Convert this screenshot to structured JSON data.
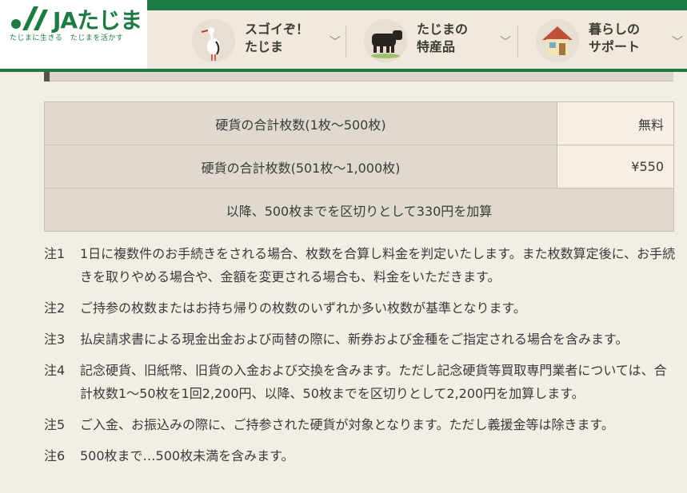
{
  "brand": {
    "logo_text": "JAたじま",
    "tagline": "たじまに生きる　たじまを活かす",
    "primary_color": "#1e7a43"
  },
  "nav": [
    {
      "label_line1": "スゴイぞ！",
      "label_line2": "たじま",
      "icon": "stork-icon"
    },
    {
      "label_line1": "たじまの",
      "label_line2": "特産品",
      "icon": "cow-icon"
    },
    {
      "label_line1": "暮らしの",
      "label_line2": "サポート",
      "icon": "house-icon"
    }
  ],
  "fee_table": {
    "rows": [
      {
        "condition": "硬貨の合計枚数(1枚～500枚)",
        "price": "無料"
      },
      {
        "condition": "硬貨の合計枚数(501枚～1,000枚)",
        "price": "¥550"
      }
    ],
    "footer": "以降、500枚までを区切りとして330円を加算"
  },
  "notes": [
    {
      "label": "注1",
      "text": "1日に複数件のお手続きをされる場合、枚数を合算し料金を判定いたします。また枚数算定後に、お手続きを取りやめる場合や、金額を変更される場合も、料金をいただきます。"
    },
    {
      "label": "注2",
      "text": "ご持参の枚数またはお持ち帰りの枚数のいずれか多い枚数が基準となります。"
    },
    {
      "label": "注3",
      "text": "払戻請求書による現金出金および両替の際に、新券および金種をご指定される場合を含みます。"
    },
    {
      "label": "注4",
      "text": "記念硬貨、旧紙幣、旧貨の入金および交換を含みます。ただし記念硬貨等買取専門業者については、合計枚数1～50枚を1回2,200円、以降、50枚までを区切りとして2,200円を加算します。"
    },
    {
      "label": "注5",
      "text": "ご入金、お振込みの際に、ご持参された硬貨が対象となります。ただし義援金等は除きます。"
    },
    {
      "label": "注6",
      "text": "500枚まで…500枚未満を含みます。"
    }
  ]
}
